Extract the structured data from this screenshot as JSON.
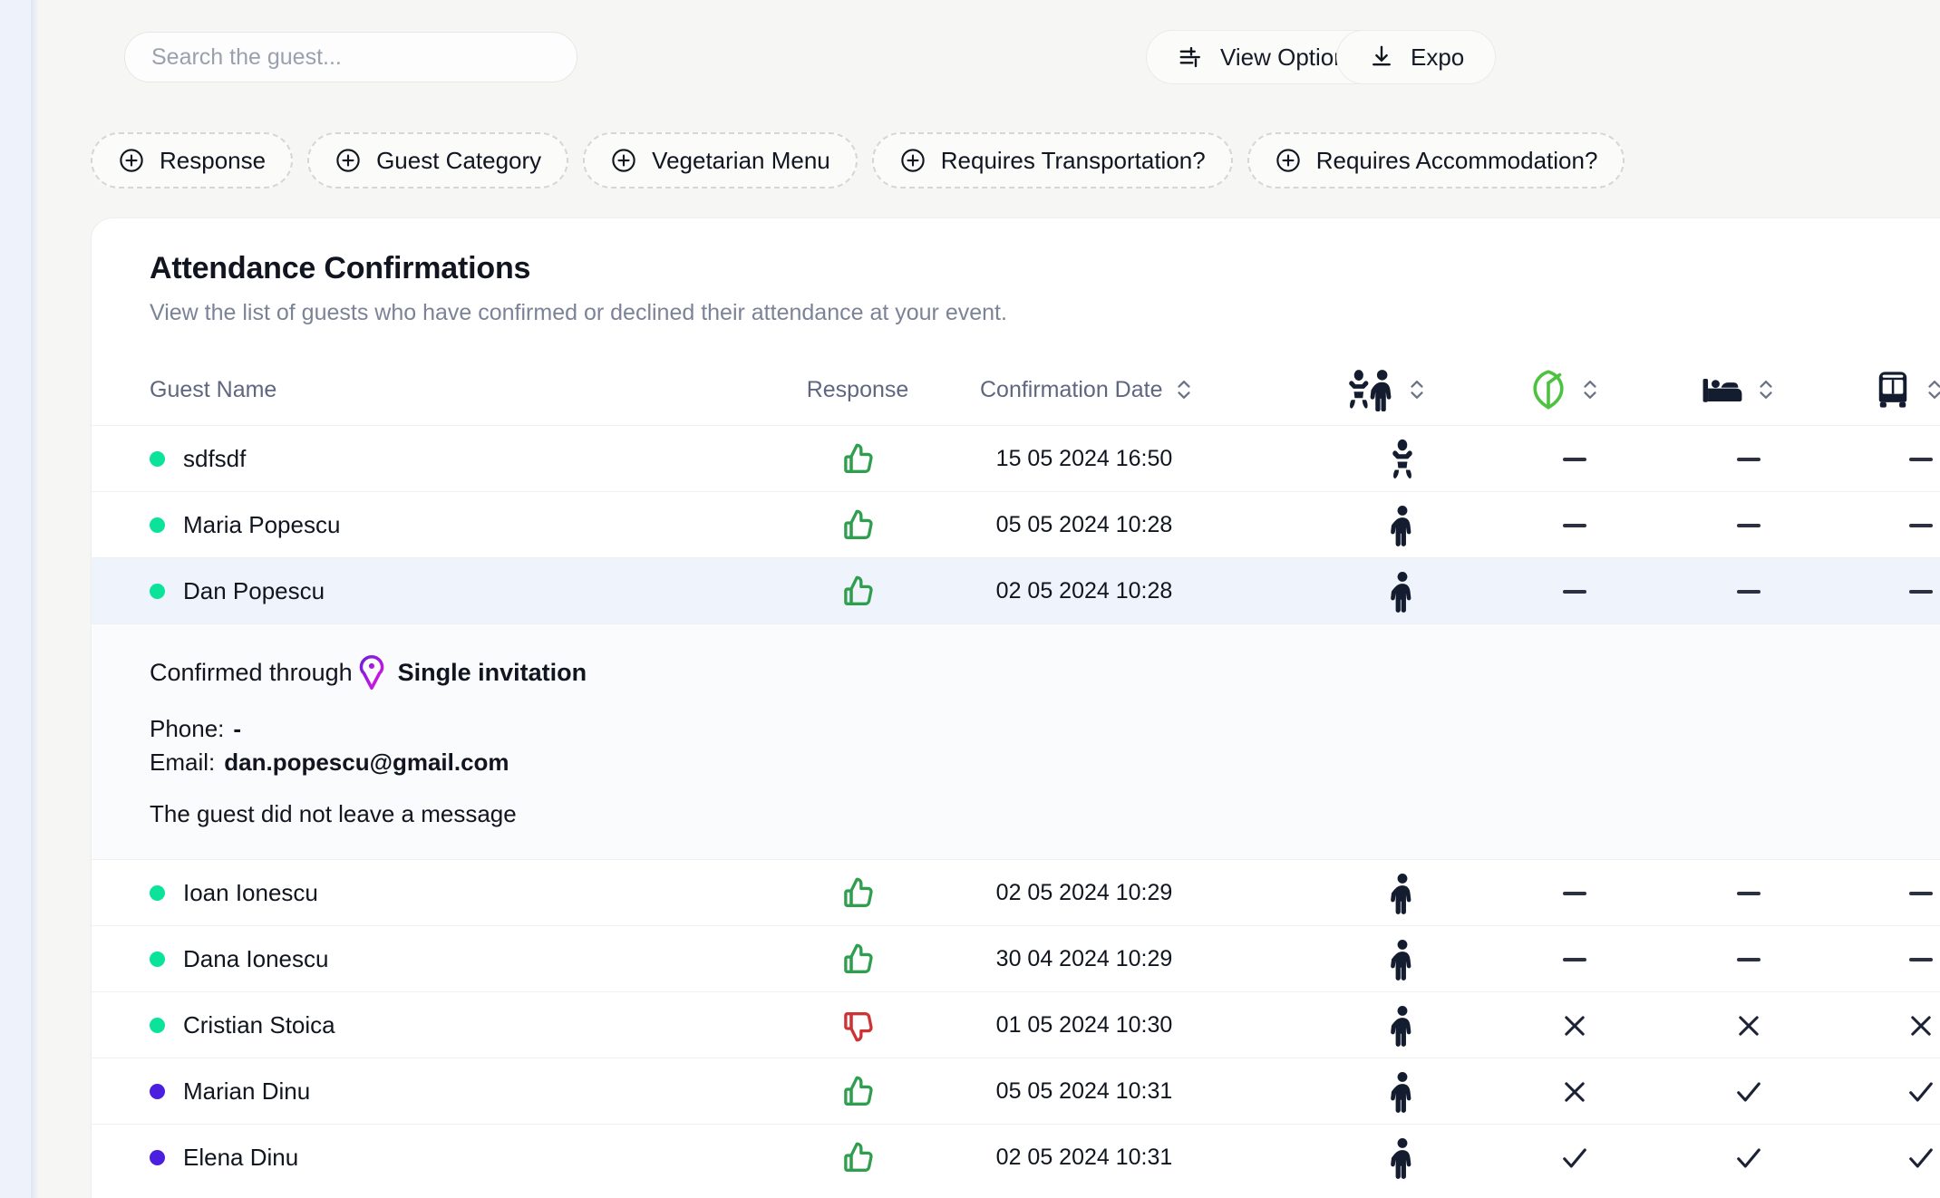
{
  "search": {
    "placeholder": "Search the guest...",
    "value": ""
  },
  "toolbar": {
    "view_options_label": "View Options",
    "export_label": "Expo",
    "view_options_icon": "sliders-icon",
    "export_icon": "download-icon"
  },
  "filters": [
    {
      "label": "Response",
      "icon": "plus-circle-icon"
    },
    {
      "label": "Guest Category",
      "icon": "plus-circle-icon"
    },
    {
      "label": "Vegetarian Menu",
      "icon": "plus-circle-icon"
    },
    {
      "label": "Requires Transportation?",
      "icon": "plus-circle-icon"
    },
    {
      "label": "Requires Accommodation?",
      "icon": "plus-circle-icon"
    }
  ],
  "card": {
    "title": "Attendance Confirmations",
    "subtitle": "View the list of guests who have confirmed or declined their attendance at your event."
  },
  "table": {
    "headers": {
      "guest_name": "Guest Name",
      "response": "Response",
      "confirmation_date": "Confirmation Date",
      "guest_category_icon": "adult-and-child-icon",
      "vegetarian_icon": "vegan-leaf-icon",
      "accommodation_icon": "bed-icon",
      "transportation_icon": "bus-icon",
      "sort_icon": "sort-chevrons-icon"
    },
    "rows": [
      {
        "name": "sdfsdf",
        "dot_color": "#0ce39a",
        "response": "thumbs-up",
        "date": "15 05 2024 16:50",
        "guest_type": "child",
        "vegetarian": "dash",
        "accommodation": "dash",
        "transportation": "dash",
        "selected": false
      },
      {
        "name": "Maria Popescu",
        "dot_color": "#0ce39a",
        "response": "thumbs-up",
        "date": "05 05 2024 10:28",
        "guest_type": "adult",
        "vegetarian": "dash",
        "accommodation": "dash",
        "transportation": "dash",
        "selected": false
      },
      {
        "name": "Dan Popescu",
        "dot_color": "#0ce39a",
        "response": "thumbs-up",
        "date": "02 05 2024 10:28",
        "guest_type": "adult",
        "vegetarian": "dash",
        "accommodation": "dash",
        "transportation": "dash",
        "selected": true
      },
      {
        "name": "Ioan Ionescu",
        "dot_color": "#0ce39a",
        "response": "thumbs-up",
        "date": "02 05 2024 10:29",
        "guest_type": "adult",
        "vegetarian": "dash",
        "accommodation": "dash",
        "transportation": "dash",
        "selected": false
      },
      {
        "name": "Dana Ionescu",
        "dot_color": "#0ce39a",
        "response": "thumbs-up",
        "date": "30 04 2024 10:29",
        "guest_type": "adult",
        "vegetarian": "dash",
        "accommodation": "dash",
        "transportation": "dash",
        "selected": false
      },
      {
        "name": "Cristian Stoica",
        "dot_color": "#0ce39a",
        "response": "thumbs-down",
        "date": "01 05 2024 10:30",
        "guest_type": "adult",
        "vegetarian": "cross",
        "accommodation": "cross",
        "transportation": "cross",
        "selected": false
      },
      {
        "name": "Marian Dinu",
        "dot_color": "#4a1fe0",
        "response": "thumbs-up",
        "date": "05 05 2024 10:31",
        "guest_type": "adult",
        "vegetarian": "cross",
        "accommodation": "check",
        "transportation": "check",
        "selected": false
      },
      {
        "name": "Elena Dinu",
        "dot_color": "#4a1fe0",
        "response": "thumbs-up",
        "date": "02 05 2024 10:31",
        "guest_type": "adult",
        "vegetarian": "check",
        "accommodation": "check",
        "transportation": "check",
        "selected": false
      }
    ]
  },
  "detail": {
    "after_row_index": 2,
    "confirmed_prefix": "Confirmed through",
    "invitation_type": "Single invitation",
    "invitation_icon": "invitation-pin-icon",
    "phone_label": "Phone:",
    "phone_value": "-",
    "email_label": "Email:",
    "email_value": "dan.popescu@gmail.com",
    "message": "The guest did not leave a message"
  },
  "colors": {
    "confirmed_green": "#0ce39a",
    "category_purple": "#4a1fe0",
    "thumbs_up": "#2f9e4e",
    "thumbs_down": "#cf3232",
    "vegan_green": "#4cc23f",
    "row_selected": "#eef3fc"
  }
}
